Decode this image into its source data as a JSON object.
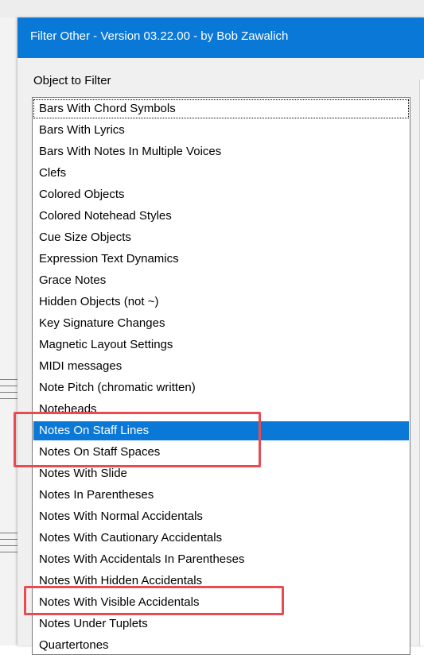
{
  "window": {
    "title": "Filter Other - Version 03.22.00 - by Bob Zawalich"
  },
  "group": {
    "label": "Object to Filter"
  },
  "list": {
    "selected_index": 15,
    "focused_index": 0,
    "items": [
      "Bars With Chord Symbols",
      "Bars With Lyrics",
      "Bars With Notes In Multiple Voices",
      "Clefs",
      "Colored Objects",
      "Colored Notehead Styles",
      "Cue Size Objects",
      "Expression Text Dynamics",
      "Grace Notes",
      "Hidden Objects (not ~)",
      "Key Signature Changes",
      "Magnetic Layout Settings",
      "MIDI messages",
      "Note Pitch (chromatic written)",
      "Noteheads",
      "Notes On Staff Lines",
      "Notes On Staff Spaces",
      "Notes With Slide",
      "Notes In Parentheses",
      "Notes With Normal Accidentals",
      "Notes With Cautionary Accidentals",
      "Notes With Accidentals In Parentheses",
      "Notes With Hidden Accidentals",
      "Notes With Visible Accidentals",
      "Notes Under Tuplets",
      "Quartertones"
    ]
  },
  "colors": {
    "title_bar": "#0a78d7",
    "selection": "#0a78d7",
    "annotation_box": "#e84b52"
  }
}
